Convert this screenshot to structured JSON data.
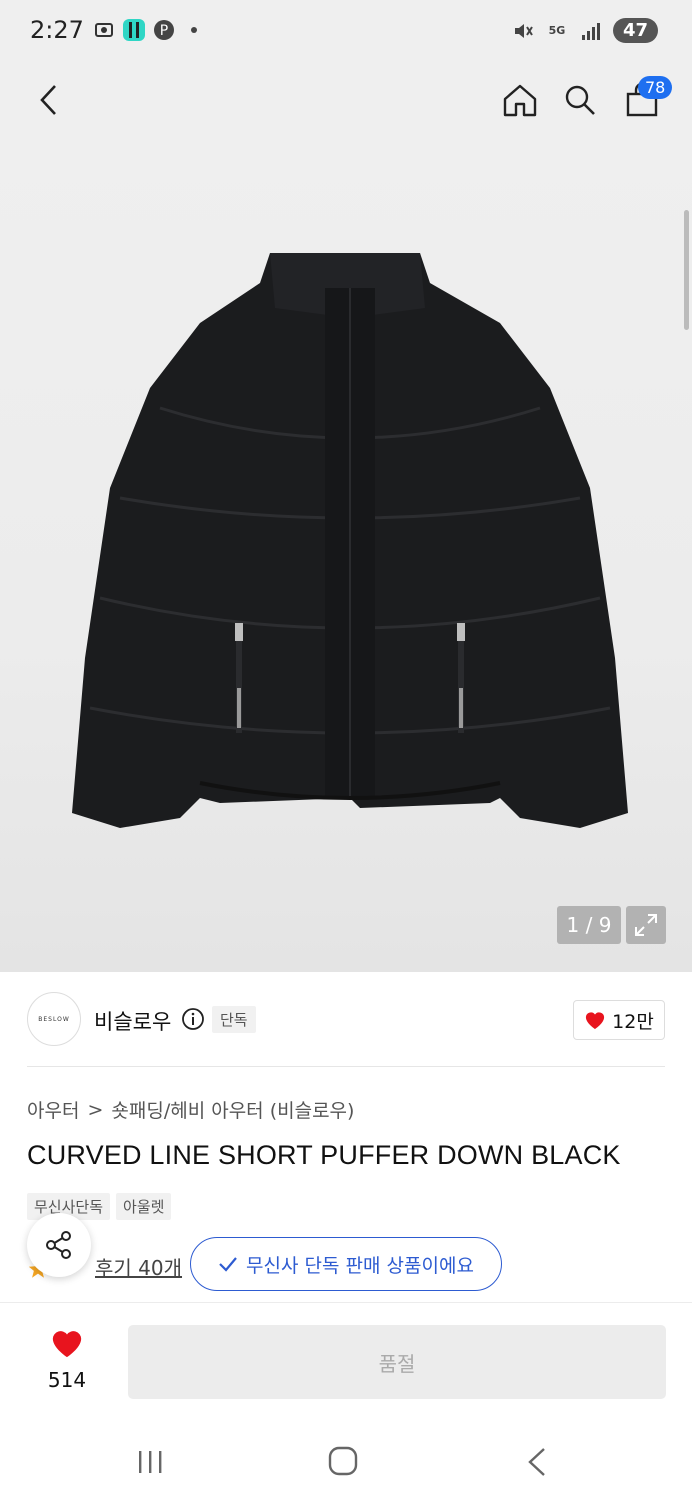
{
  "status_bar": {
    "time": "2:27",
    "battery": "47",
    "network": "5G",
    "icons": [
      "screenshot-icon",
      "app-icon",
      "pinterest-icon",
      "dot-icon",
      "mute-icon",
      "signal-icon"
    ]
  },
  "header": {
    "cart_count": "78",
    "icons": [
      "back-icon",
      "home-icon",
      "search-icon",
      "cart-icon"
    ]
  },
  "gallery": {
    "counter": "1 / 9"
  },
  "brand": {
    "logo_text": "BESLOW",
    "name": "비슬로우",
    "exclusive_tag": "단독",
    "like_count": "12만"
  },
  "breadcrumb": {
    "category": "아우터",
    "separator": ">",
    "subcategory": "숏패딩/헤비 아우터 (비슬로우)"
  },
  "product": {
    "title": "CURVED LINE SHORT PUFFER DOWN BLACK",
    "tags": [
      "무신사단독",
      "아울렛"
    ],
    "review_link": "후기 40개",
    "exclusive_pill": "무신사 단독 판매 상품이에요"
  },
  "bottom_bar": {
    "wish_count": "514",
    "soldout_label": "품절"
  },
  "colors": {
    "accent_blue": "#2d5bd1",
    "badge_blue": "#1e6ff0",
    "heart_red": "#e8141e",
    "star_orange": "#f5a623"
  }
}
